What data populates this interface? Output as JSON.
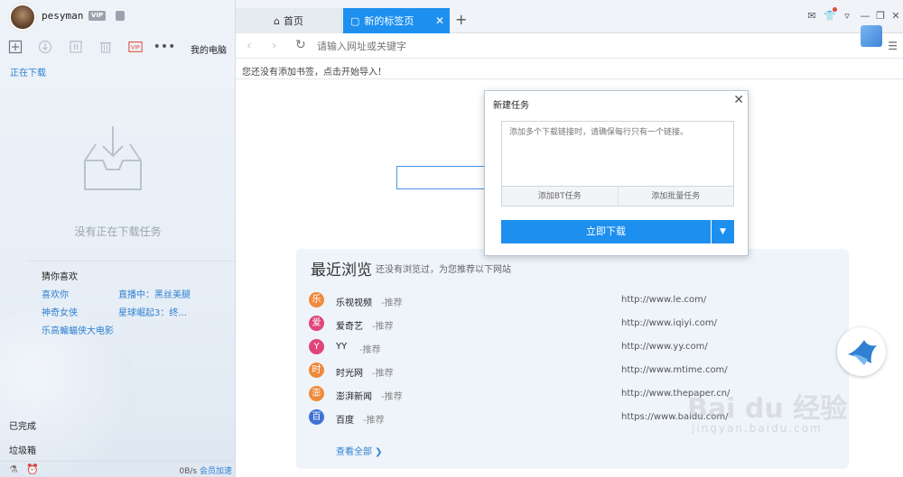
{
  "profile": {
    "username": "pesyman",
    "vip_label": "VIP"
  },
  "sidebar": {
    "my_pc": "我的电脑",
    "downloading_title": "正在下载",
    "empty_text": "没有正在下载任务",
    "guess_title": "猜你喜欢",
    "guess_links": [
      "喜欢你",
      "直播中：黑丝美腿",
      "神奇女侠",
      "星球崛起3：终...",
      "乐高蝙蝠侠大电影"
    ],
    "completed": "已完成",
    "trash": "垃圾箱",
    "speed": "0B/s",
    "boost": "会员加速"
  },
  "tabs": {
    "home": "首页",
    "active": "新的标签页"
  },
  "address": {
    "placeholder": "请输入网址或关键字"
  },
  "bookmarks": {
    "empty": "您还没有添加书签，点击开始导入！"
  },
  "recent": {
    "title": "最近浏览",
    "subtitle": "还没有浏览过，为您推荐以下网站",
    "sites": [
      {
        "icon": "乐",
        "name": "乐视视频",
        "tag": "-推荐",
        "url": "http://www.le.com/",
        "color": "#f08a3c"
      },
      {
        "icon": "爱",
        "name": "爱奇艺",
        "tag": "-推荐",
        "url": "http://www.iqiyi.com/",
        "color": "#e0457a"
      },
      {
        "icon": "Y",
        "name": "YY",
        "tag": "-推荐",
        "url": "http://www.yy.com/",
        "color": "#e0457a"
      },
      {
        "icon": "时",
        "name": "时光网",
        "tag": "-推荐",
        "url": "http://www.mtime.com/",
        "color": "#f08a3c"
      },
      {
        "icon": "澎",
        "name": "澎湃新闻",
        "tag": "-推荐",
        "url": "http://www.thepaper.cn/",
        "color": "#f08a3c"
      },
      {
        "icon": "百",
        "name": "百度",
        "tag": "-推荐",
        "url": "https://www.baidu.com/",
        "color": "#3f72d6"
      }
    ],
    "view_all": "查看全部 ❯"
  },
  "dialog": {
    "title": "新建任务",
    "placeholder": "添加多个下载链接时，请确保每行只有一个链接。",
    "add_bt": "添加BT任务",
    "add_batch": "添加批量任务",
    "download": "立即下载"
  },
  "watermark": {
    "logo": "Bai du 经验",
    "url": "jingyan.baidu.com"
  }
}
